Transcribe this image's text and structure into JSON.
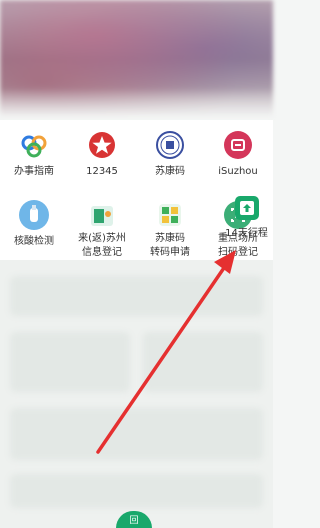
{
  "services": {
    "row1": [
      {
        "label": "办事指南",
        "icon": "guide-rings-icon"
      },
      {
        "label": "12345",
        "icon": "red-star-icon"
      },
      {
        "label": "苏康码",
        "icon": "su-health-code-emblem-icon"
      },
      {
        "label": "iSuzhou",
        "icon": "isuzhou-logo-icon"
      }
    ],
    "row2": [
      {
        "label": "核酸检测",
        "icon": "nucleic-test-icon"
      },
      {
        "label1": "来(返)苏州",
        "label2": "信息登记",
        "icon": "registration-icon"
      },
      {
        "label1": "苏康码",
        "label2": "转码申请",
        "icon": "code-transfer-icon"
      },
      {
        "label1": "重点场所",
        "label2": "扫码登记",
        "icon": "venue-scan-icon"
      },
      {
        "label": "14天行程",
        "icon": "itinerary-upload-icon"
      }
    ]
  },
  "bottom_nav": {
    "center_label": "回"
  },
  "colors": {
    "green": "#19a86b",
    "arrow_red": "#e53030"
  }
}
